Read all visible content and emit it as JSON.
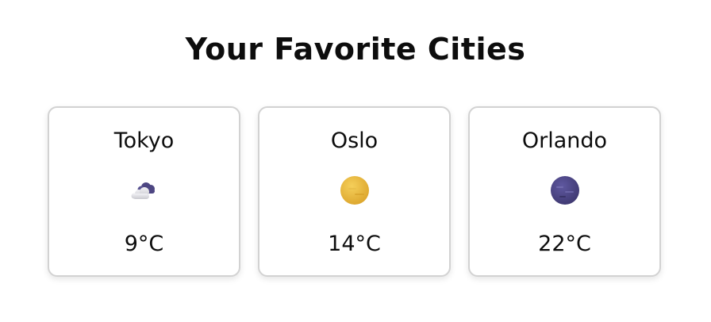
{
  "title": "Your Favorite Cities",
  "cities": [
    {
      "name": "Tokyo",
      "temp": "9°C",
      "icon": "cloudy-night-icon"
    },
    {
      "name": "Oslo",
      "temp": "14°C",
      "icon": "sun-icon"
    },
    {
      "name": "Orlando",
      "temp": "22°C",
      "icon": "moon-icon"
    }
  ],
  "colors": {
    "sun": "#e8b93a",
    "moon": "#4b4580",
    "cloud_dark": "#4d4682",
    "cloud_light": "#d9d9de",
    "card_border": "#d2d2d2"
  }
}
